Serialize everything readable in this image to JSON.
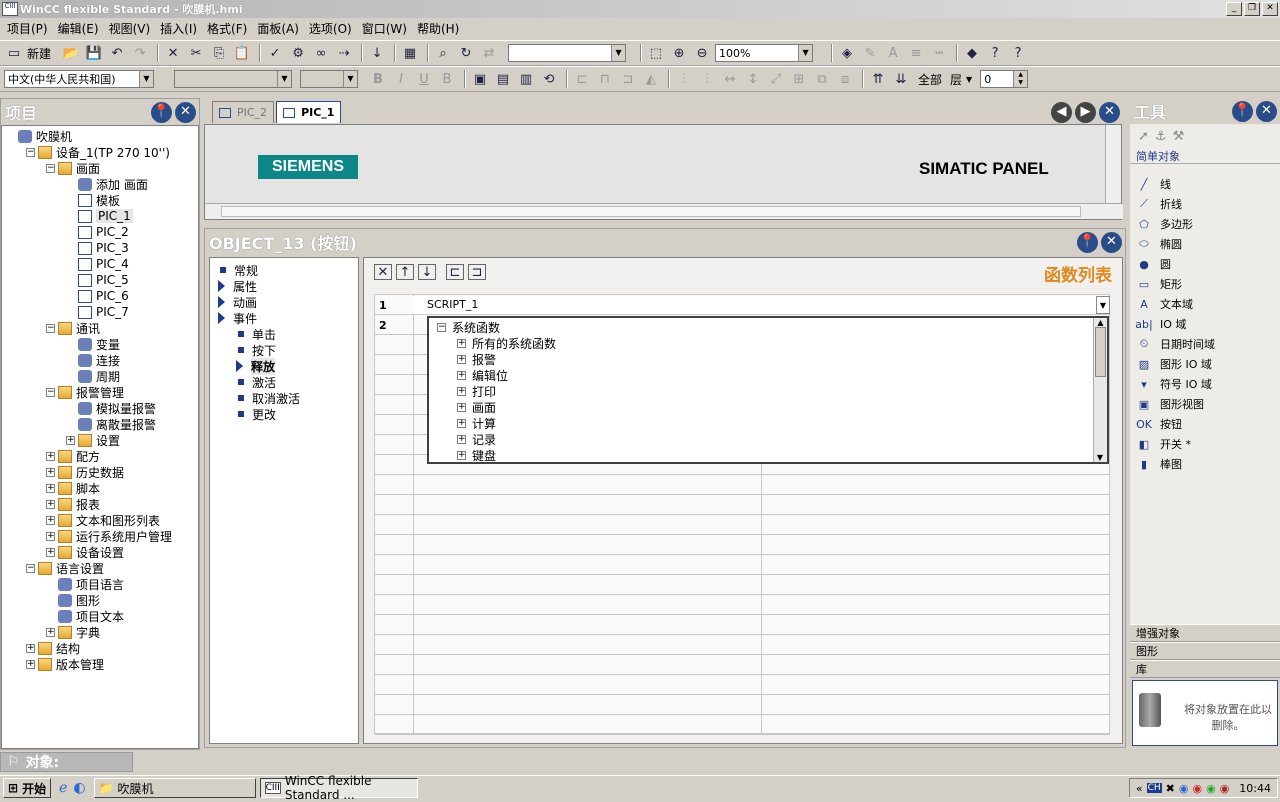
{
  "window": {
    "title": "WinCC flexible Standard - 吹膜机.hmi"
  },
  "menu": [
    "项目(P)",
    "编辑(E)",
    "视图(V)",
    "插入(I)",
    "格式(F)",
    "面板(A)",
    "选项(O)",
    "窗口(W)",
    "帮助(H)"
  ],
  "toolbar": {
    "new_label": "新建",
    "zoom_value": "100%",
    "language_value": "中文(中华人民共和国)",
    "all_label": "全部",
    "layer_label": "层",
    "layer_value": "0"
  },
  "project_panel": {
    "title": "项目",
    "tree": [
      {
        "label": "吹膜机",
        "level": 0
      },
      {
        "label": "设备_1(TP 270 10'')",
        "level": 1,
        "exp": "−"
      },
      {
        "label": "画面",
        "level": 2,
        "exp": "−"
      },
      {
        "label": "添加 画面",
        "level": 3
      },
      {
        "label": "模板",
        "level": 3
      },
      {
        "label": "PIC_1",
        "level": 3,
        "sel": true
      },
      {
        "label": "PIC_2",
        "level": 3
      },
      {
        "label": "PIC_3",
        "level": 3
      },
      {
        "label": "PIC_4",
        "level": 3
      },
      {
        "label": "PIC_5",
        "level": 3
      },
      {
        "label": "PIC_6",
        "level": 3
      },
      {
        "label": "PIC_7",
        "level": 3
      },
      {
        "label": "通讯",
        "level": 2,
        "exp": "−"
      },
      {
        "label": "变量",
        "level": 3
      },
      {
        "label": "连接",
        "level": 3
      },
      {
        "label": "周期",
        "level": 3
      },
      {
        "label": "报警管理",
        "level": 2,
        "exp": "−"
      },
      {
        "label": "模拟量报警",
        "level": 3
      },
      {
        "label": "离散量报警",
        "level": 3
      },
      {
        "label": "设置",
        "level": 3,
        "exp": "+"
      },
      {
        "label": "配方",
        "level": 2,
        "exp": "+"
      },
      {
        "label": "历史数据",
        "level": 2,
        "exp": "+"
      },
      {
        "label": "脚本",
        "level": 2,
        "exp": "+"
      },
      {
        "label": "报表",
        "level": 2,
        "exp": "+"
      },
      {
        "label": "文本和图形列表",
        "level": 2,
        "exp": "+"
      },
      {
        "label": "运行系统用户管理",
        "level": 2,
        "exp": "+"
      },
      {
        "label": "设备设置",
        "level": 2,
        "exp": "+"
      },
      {
        "label": "语言设置",
        "level": 1,
        "exp": "−"
      },
      {
        "label": "项目语言",
        "level": 2
      },
      {
        "label": "图形",
        "level": 2
      },
      {
        "label": "项目文本",
        "level": 2
      },
      {
        "label": "字典",
        "level": 2,
        "exp": "+"
      },
      {
        "label": "结构",
        "level": 1,
        "exp": "+"
      },
      {
        "label": "版本管理",
        "level": 1,
        "exp": "+"
      }
    ]
  },
  "tabs": [
    "PIC_2",
    "PIC_1"
  ],
  "screen": {
    "brand": "SIEMENS",
    "panel_label": "SIMATIC PANEL"
  },
  "object_panel": {
    "title": "OBJECT_13 (按钮)",
    "nav": [
      {
        "label": "常规",
        "kind": "bullet"
      },
      {
        "label": "属性",
        "kind": "tri"
      },
      {
        "label": "动画",
        "kind": "tri"
      },
      {
        "label": "事件",
        "kind": "tri"
      },
      {
        "label": "单击",
        "kind": "sub"
      },
      {
        "label": "按下",
        "kind": "sub"
      },
      {
        "label": "释放",
        "kind": "active"
      },
      {
        "label": "激活",
        "kind": "sub"
      },
      {
        "label": "取消激活",
        "kind": "sub"
      },
      {
        "label": "更改",
        "kind": "sub"
      }
    ],
    "function_list_label": "函数列表",
    "rows": [
      {
        "num": "1",
        "value": "SCRIPT_1"
      },
      {
        "num": "2",
        "value": ""
      }
    ],
    "dropdown": [
      {
        "label": "系统函数",
        "exp": "−",
        "indent": 0
      },
      {
        "label": "所有的系统函数",
        "exp": "+",
        "indent": 1
      },
      {
        "label": "报警",
        "exp": "+",
        "indent": 1
      },
      {
        "label": "编辑位",
        "exp": "+",
        "indent": 1
      },
      {
        "label": "打印",
        "exp": "+",
        "indent": 1
      },
      {
        "label": "画面",
        "exp": "+",
        "indent": 1
      },
      {
        "label": "计算",
        "exp": "+",
        "indent": 1
      },
      {
        "label": "记录",
        "exp": "+",
        "indent": 1
      },
      {
        "label": "键盘",
        "exp": "+",
        "indent": 1
      }
    ]
  },
  "tools_panel": {
    "title": "工具",
    "section_simple": "简单对象",
    "items": [
      {
        "label": "线",
        "icon": "line-icon"
      },
      {
        "label": "折线",
        "icon": "polyline-icon"
      },
      {
        "label": "多边形",
        "icon": "polygon-icon"
      },
      {
        "label": "椭圆",
        "icon": "ellipse-icon"
      },
      {
        "label": "圆",
        "icon": "circle-icon"
      },
      {
        "label": "矩形",
        "icon": "rectangle-icon"
      },
      {
        "label": "文本域",
        "icon": "text-icon"
      },
      {
        "label": "IO 域",
        "icon": "io-field-icon"
      },
      {
        "label": "日期时间域",
        "icon": "datetime-icon"
      },
      {
        "label": "图形 IO 域",
        "icon": "graphic-io-icon"
      },
      {
        "label": "符号 IO 域",
        "icon": "symbol-io-icon"
      },
      {
        "label": "图形视图",
        "icon": "graphic-view-icon"
      },
      {
        "label": "按钮",
        "icon": "button-icon"
      },
      {
        "label": "开关 *",
        "icon": "switch-icon"
      },
      {
        "label": "棒图",
        "icon": "bar-icon"
      }
    ],
    "section_enhanced": "增强对象",
    "section_graphics": "图形",
    "section_library": "库",
    "drop_hint": "将对象放置在此以删除。"
  },
  "objects_bar": {
    "label": "对象:"
  },
  "taskbar": {
    "start": "开始",
    "folder": "吹膜机",
    "app": "WinCC flexible Standard ...",
    "clock": "10:44"
  }
}
